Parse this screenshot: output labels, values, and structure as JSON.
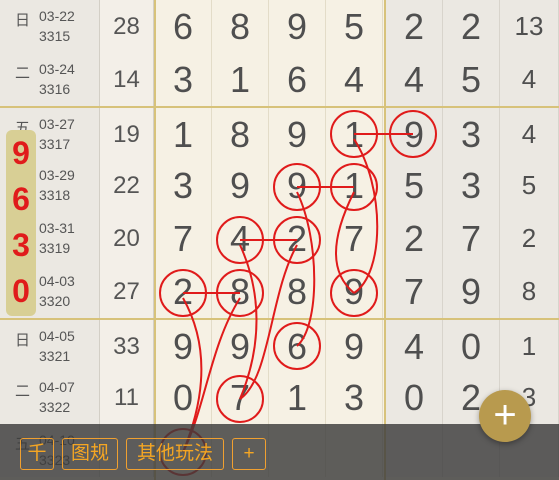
{
  "rows": [
    {
      "weekday": "日",
      "date": "03-22",
      "period": "3315",
      "sum": "28",
      "digits": [
        "6",
        "8",
        "9",
        "5"
      ],
      "right": [
        "2",
        "2",
        "13"
      ]
    },
    {
      "weekday": "二",
      "date": "03-24",
      "period": "3316",
      "sum": "14",
      "digits": [
        "3",
        "1",
        "6",
        "4"
      ],
      "right": [
        "4",
        "5",
        "4"
      ]
    },
    {
      "weekday": "五",
      "date": "03-27",
      "period": "3317",
      "sum": "19",
      "digits": [
        "1",
        "8",
        "9",
        "1"
      ],
      "right": [
        "9",
        "3",
        "4"
      ]
    },
    {
      "weekday": "",
      "date": "03-29",
      "period": "3318",
      "sum": "22",
      "digits": [
        "3",
        "9",
        "9",
        "1"
      ],
      "right": [
        "5",
        "3",
        "5"
      ]
    },
    {
      "weekday": "",
      "date": "03-31",
      "period": "3319",
      "sum": "20",
      "digits": [
        "7",
        "4",
        "2",
        "7"
      ],
      "right": [
        "2",
        "7",
        "2"
      ]
    },
    {
      "weekday": "",
      "date": "04-03",
      "period": "3320",
      "sum": "27",
      "digits": [
        "2",
        "8",
        "8",
        "9"
      ],
      "right": [
        "7",
        "9",
        "8"
      ]
    },
    {
      "weekday": "日",
      "date": "04-05",
      "period": "3321",
      "sum": "33",
      "digits": [
        "9",
        "9",
        "6",
        "9"
      ],
      "right": [
        "4",
        "0",
        "1"
      ]
    },
    {
      "weekday": "二",
      "date": "04-07",
      "period": "3322",
      "sum": "11",
      "digits": [
        "0",
        "7",
        "1",
        "3"
      ],
      "right": [
        "0",
        "2",
        "3"
      ]
    },
    {
      "weekday": "五",
      "date": "04-10",
      "period": "3323",
      "sum": "",
      "digits": [
        "",
        "",
        "",
        ""
      ],
      "right": [
        "",
        "",
        ""
      ]
    }
  ],
  "side_badge": [
    "9",
    "6",
    "3",
    "0"
  ],
  "toolbar": {
    "btn1": "千",
    "btn2": "图规",
    "btn3": "其他玩法",
    "btn4": "+"
  },
  "fab_label": "+",
  "colors": {
    "accent": "#e01b1b",
    "gold": "#d7c27a",
    "toolbar_text": "#f5a623"
  }
}
